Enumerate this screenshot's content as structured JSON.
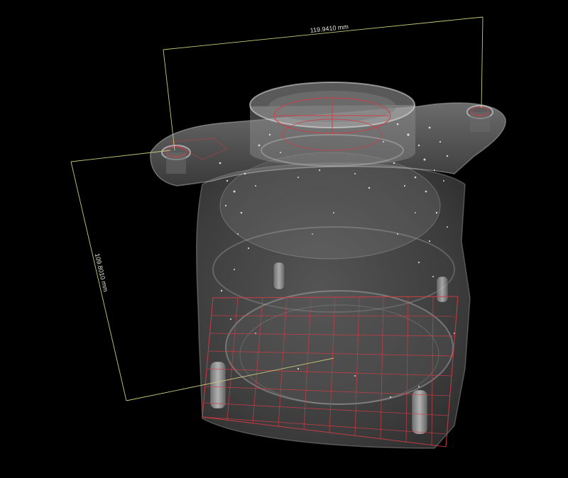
{
  "measurements": {
    "width_label": "119.9410 mm",
    "height_label": "109.8010 mm"
  },
  "colors": {
    "background": "#000000",
    "dimension_line": "#c8c87a",
    "grid_line": "#d23c46",
    "part_body": "#8a8a8a"
  },
  "icons": {
    "scene": "ct-scan-3d-part"
  }
}
